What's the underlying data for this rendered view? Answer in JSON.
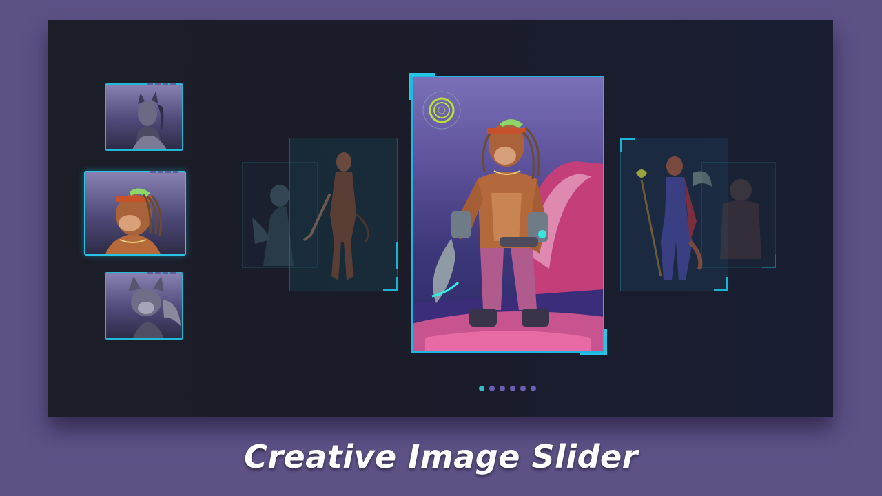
{
  "caption": "Creative Image Slider",
  "colors": {
    "background": "#5d5186",
    "stage": "#1b1d27",
    "accent": "#1fb6e0",
    "dot_active": "#35b9c6",
    "dot_inactive": "#6a5fb0"
  },
  "thumbnails": [
    {
      "character": "panther-woman",
      "active": false
    },
    {
      "character": "monkey-warrior",
      "active": true
    },
    {
      "character": "fox-girl",
      "active": false
    }
  ],
  "slides": [
    {
      "character": "fox-warrior",
      "state": "far-left"
    },
    {
      "character": "panther-woman",
      "state": "left"
    },
    {
      "character": "monkey-warrior",
      "state": "center"
    },
    {
      "character": "fox-girl-mage",
      "state": "right"
    },
    {
      "character": "beast-warrior",
      "state": "far-right"
    }
  ],
  "pagination": {
    "count": 6,
    "active_index": 0
  },
  "icons": {
    "target": "target-icon"
  }
}
